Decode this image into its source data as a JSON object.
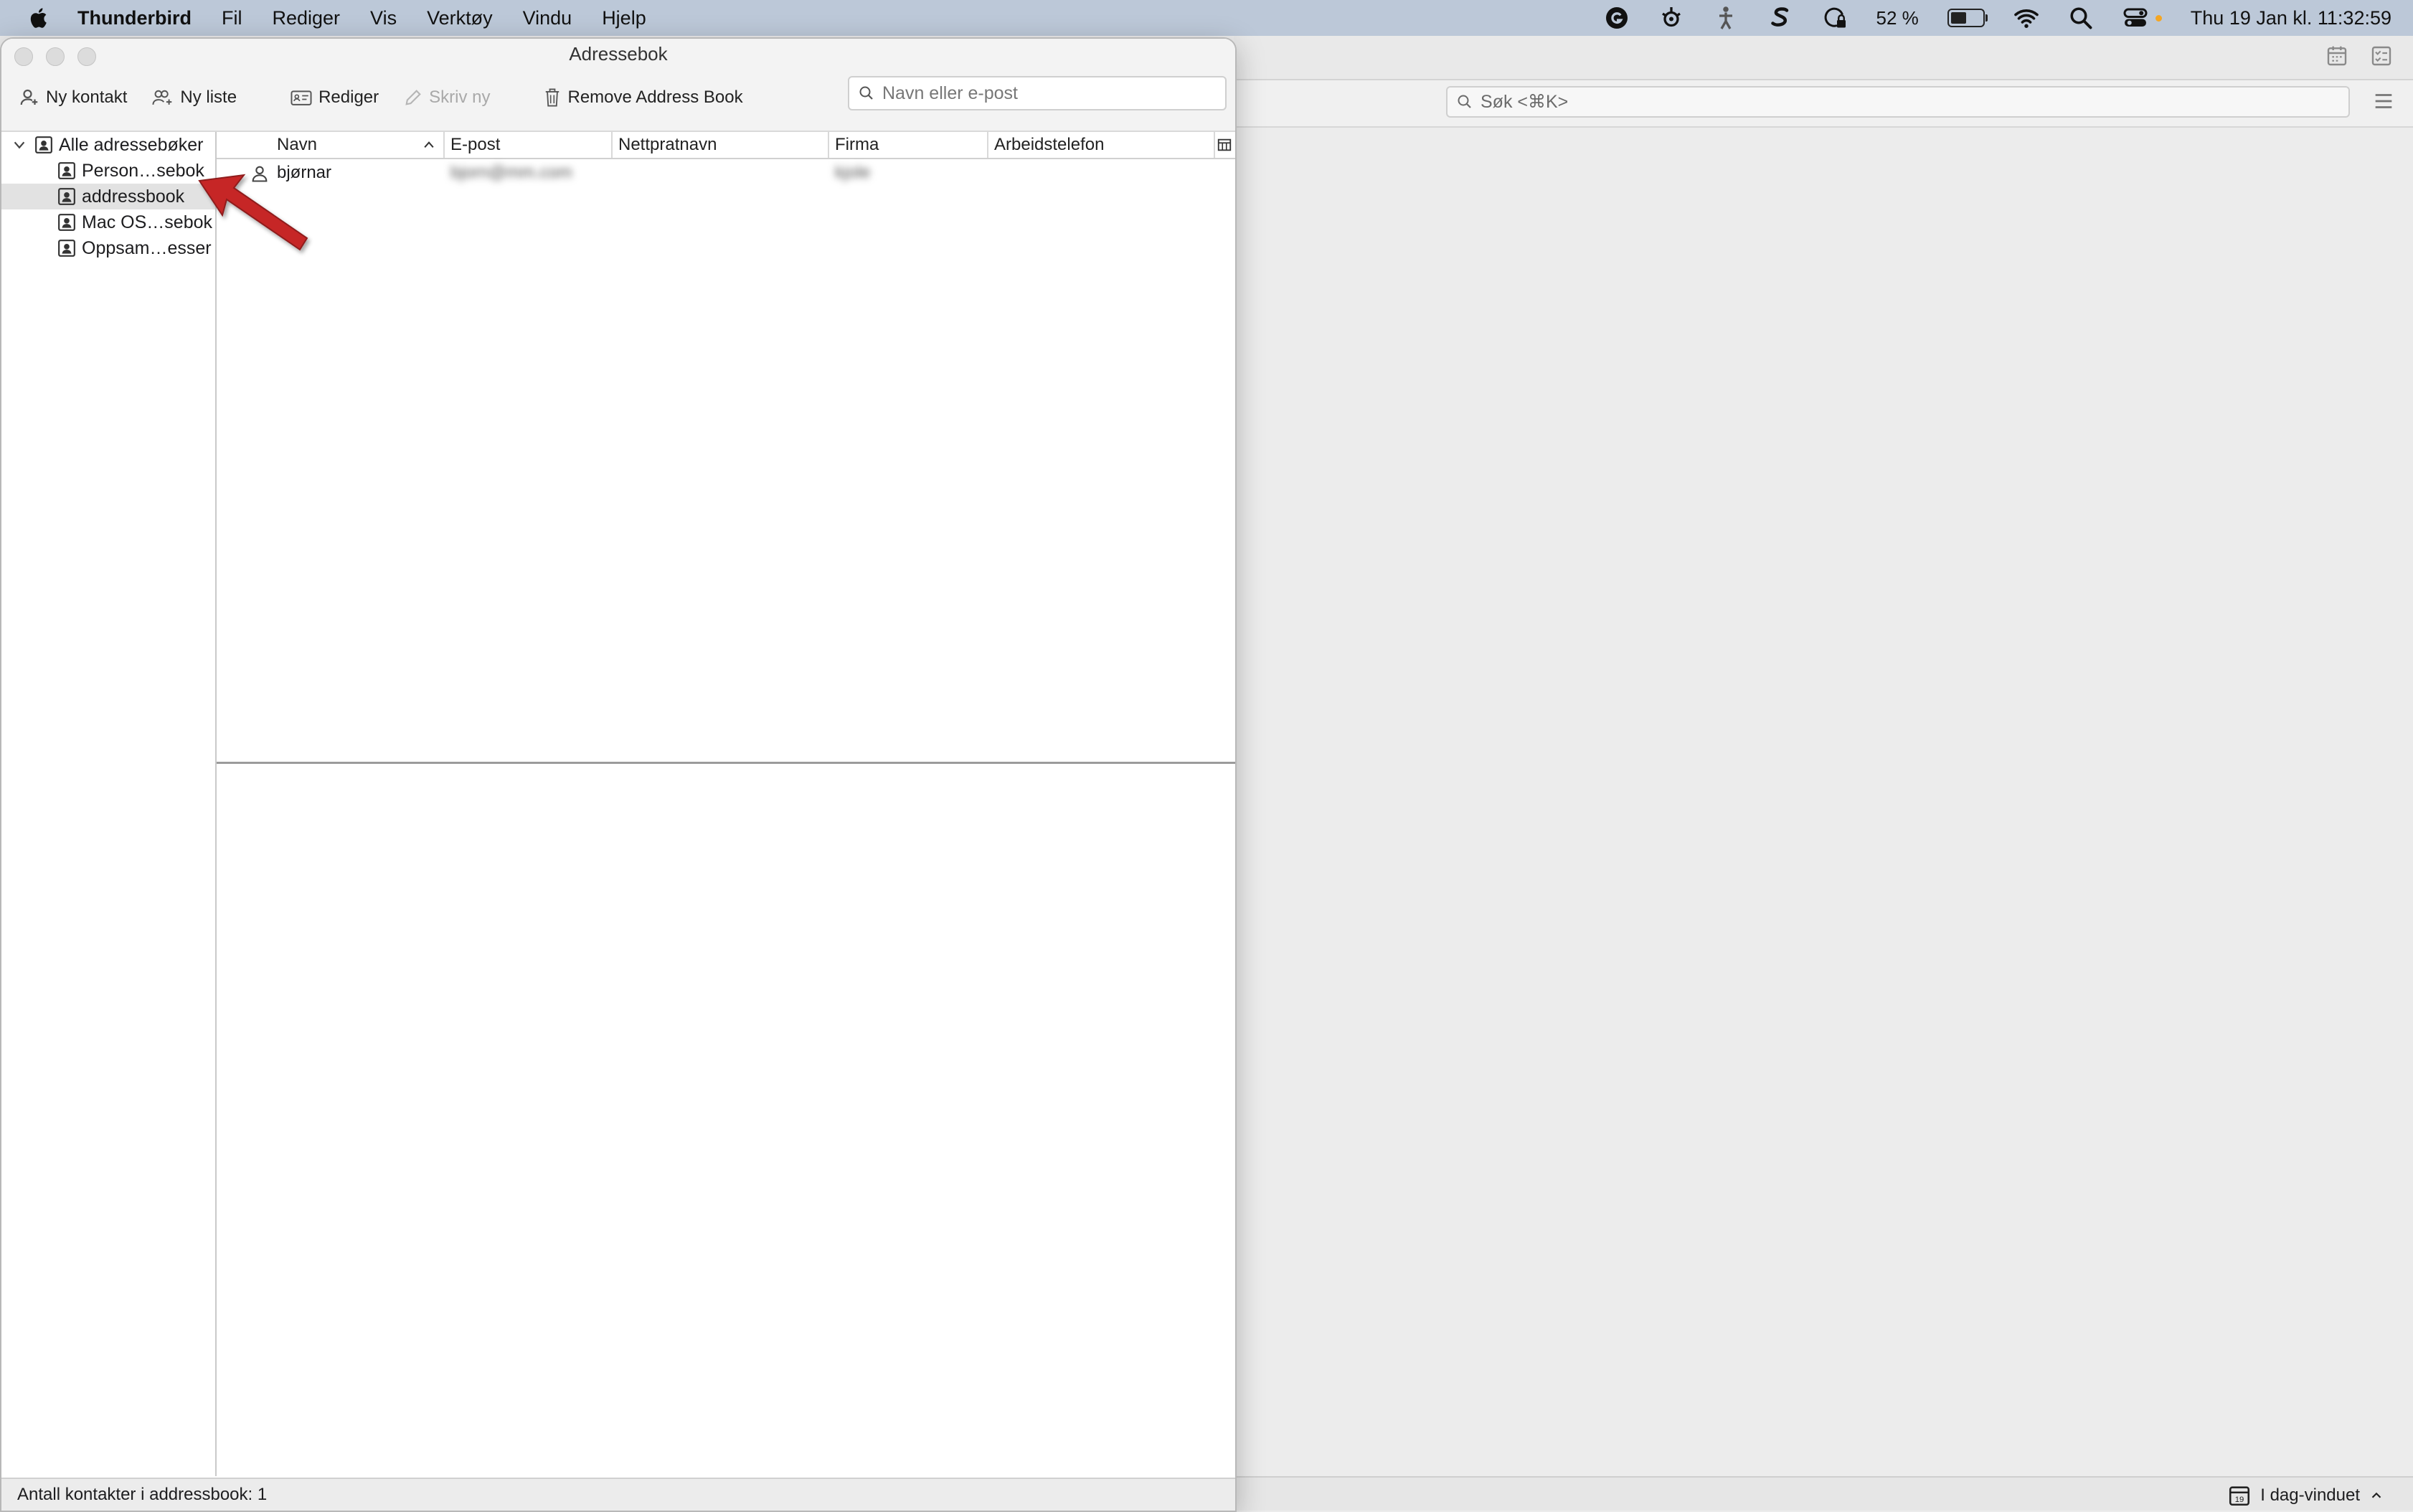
{
  "menubar": {
    "app_name": "Thunderbird",
    "items": [
      "Fil",
      "Rediger",
      "Vis",
      "Verktøy",
      "Vindu",
      "Hjelp"
    ],
    "battery_percent": "52 %",
    "battery_level": 0.52,
    "clock": "Thu 19 Jan kl. 11:32:59",
    "status_icons": [
      "grammarly-icon",
      "steelseries-icon",
      "accessibility-icon",
      "shortcut-s-icon",
      "vpn-lock-icon",
      "battery-icon",
      "wifi-icon",
      "spotlight-search-icon",
      "control-center-icon"
    ]
  },
  "main_window": {
    "search_placeholder": "Søk <⌘K>",
    "status": {
      "today_pane_label": "I dag-vinduet",
      "calendar_day": "19"
    }
  },
  "address_book": {
    "window_title": "Adressebok",
    "toolbar": {
      "new_contact": "Ny kontakt",
      "new_list": "Ny liste",
      "edit": "Rediger",
      "write": "Skriv ny",
      "remove_book": "Remove Address Book"
    },
    "search_placeholder": "Navn eller e-post",
    "directories": [
      {
        "label": "Alle adressebøker",
        "selected": false
      },
      {
        "label": "Person…sebok",
        "selected": false
      },
      {
        "label": "addressbook",
        "selected": true
      },
      {
        "label": "Mac OS…sebok",
        "selected": false
      },
      {
        "label": "Oppsam…esser",
        "selected": false
      }
    ],
    "columns": [
      "Navn",
      "E-post",
      "Nettpratnavn",
      "Firma",
      "Arbeidstelefon"
    ],
    "contacts": [
      {
        "name": "bjørnar",
        "email": "bjorn@mm.com",
        "chat": "",
        "company": "kjole",
        "work_phone": ""
      }
    ],
    "status_text": "Antall kontakter i addressbook: 1"
  }
}
